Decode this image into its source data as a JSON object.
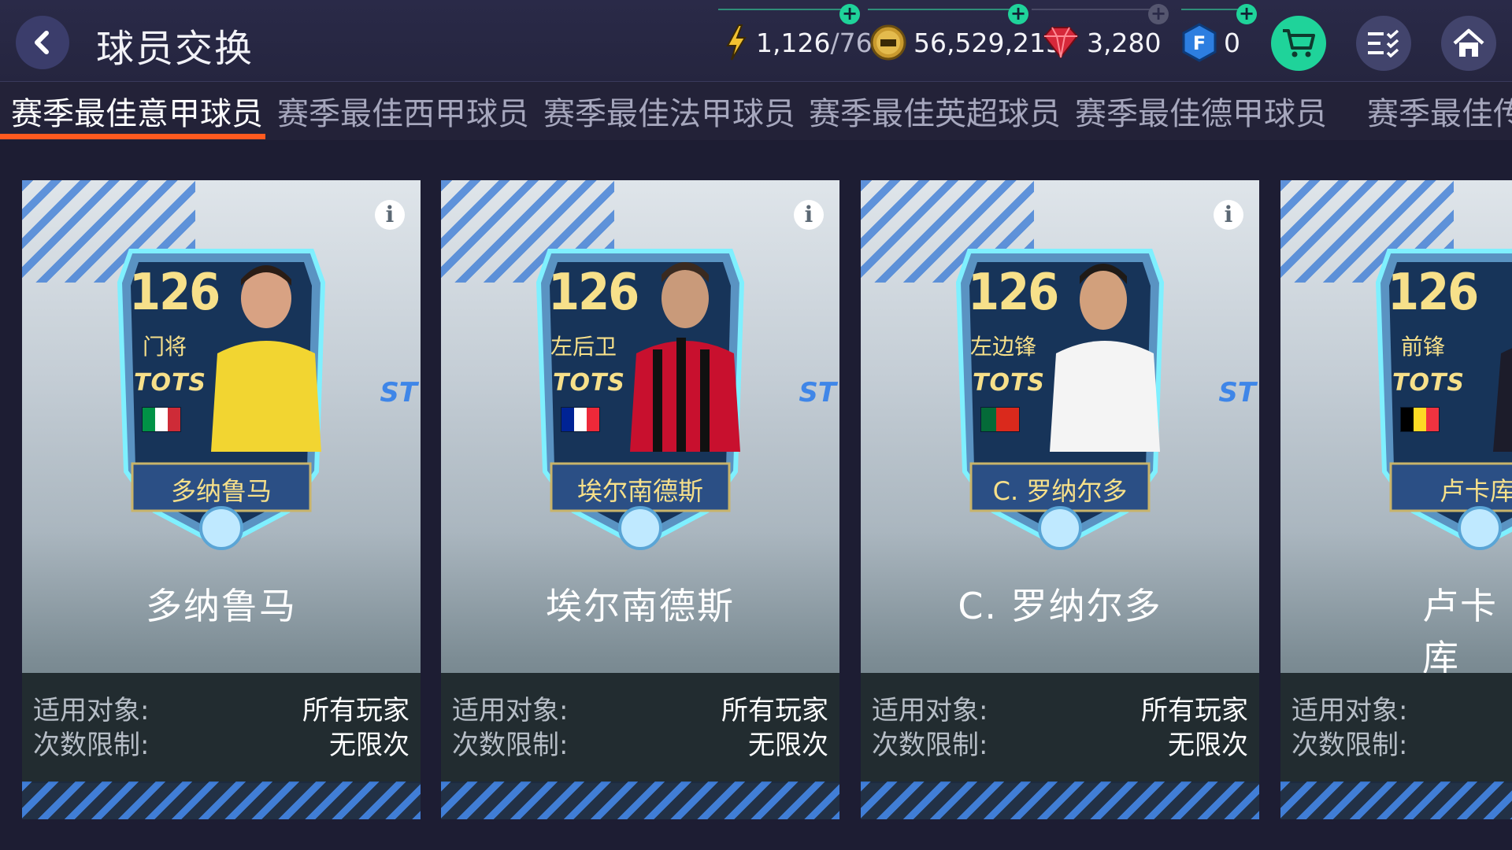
{
  "header": {
    "title": "球员交换",
    "resources": {
      "energy": {
        "current": "1,126",
        "max": "/76"
      },
      "coins": "56,529,215",
      "gems": "3,280",
      "fifa_points": "0"
    }
  },
  "tabs": [
    {
      "label": "赛季最佳意甲球员",
      "active": true
    },
    {
      "label": "赛季最佳西甲球员",
      "active": false
    },
    {
      "label": "赛季最佳法甲球员",
      "active": false
    },
    {
      "label": "赛季最佳英超球员",
      "active": false
    },
    {
      "label": "赛季最佳德甲球员",
      "active": false
    },
    {
      "label": "赛季最佳传",
      "active": false
    }
  ],
  "cards": [
    {
      "rating": "126",
      "position": "门将",
      "program": "TOTS",
      "card_name": "多纳鲁马",
      "title": "多纳鲁马",
      "eligible_label": "适用对象:",
      "eligible_value": "所有玩家",
      "limit_label": "次数限制:",
      "limit_value": "无限次",
      "flag": [
        "#009246",
        "#ffffff",
        "#ce2b37"
      ],
      "kit": "#f2d531"
    },
    {
      "rating": "126",
      "position": "左后卫",
      "program": "TOTS",
      "card_name": "埃尔南德斯",
      "title": "埃尔南德斯",
      "eligible_label": "适用对象:",
      "eligible_value": "所有玩家",
      "limit_label": "次数限制:",
      "limit_value": "无限次",
      "flag": [
        "#002395",
        "#ffffff",
        "#ed2939"
      ],
      "kit": "#c8102e"
    },
    {
      "rating": "126",
      "position": "左边锋",
      "program": "TOTS",
      "card_name": "C. 罗纳尔多",
      "title": "C. 罗纳尔多",
      "eligible_label": "适用对象:",
      "eligible_value": "所有玩家",
      "limit_label": "次数限制:",
      "limit_value": "无限次",
      "flag": [
        "#046a38",
        "#da291c",
        "#da291c"
      ],
      "kit": "#f4f4f4"
    },
    {
      "rating": "126",
      "position": "前锋",
      "program": "TOTS",
      "card_name": "卢卡库",
      "title": "卢卡库",
      "eligible_label": "适用对象:",
      "eligible_value": "",
      "limit_label": "次数限制:",
      "limit_value": "",
      "flag": [
        "#000000",
        "#fdda24",
        "#ef3340"
      ],
      "kit": "#1c1c2a"
    }
  ],
  "colors": {
    "tab_active_underline": "#ff5a1f",
    "plus": "#1fd39a",
    "cart": "#1fd39a"
  }
}
